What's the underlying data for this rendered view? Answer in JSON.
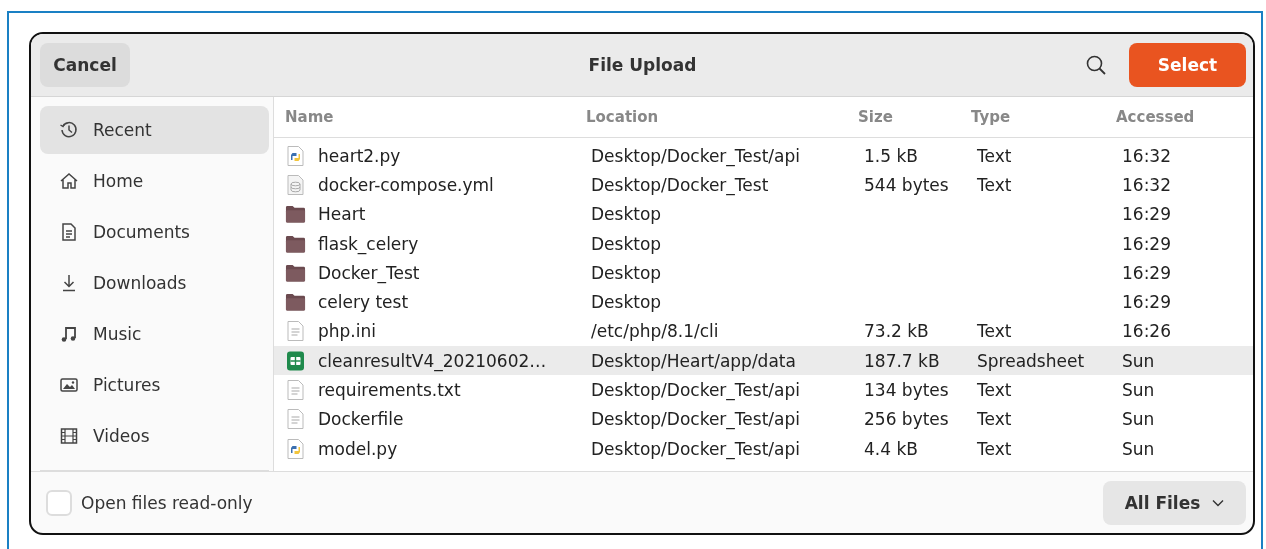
{
  "header": {
    "cancel": "Cancel",
    "title": "File Upload",
    "select": "Select"
  },
  "sidebar": {
    "items": [
      {
        "label": "Recent",
        "kind": "recent",
        "selected": true
      },
      {
        "label": "Home",
        "kind": "home",
        "selected": false
      },
      {
        "label": "Documents",
        "kind": "documents",
        "selected": false
      },
      {
        "label": "Downloads",
        "kind": "downloads",
        "selected": false
      },
      {
        "label": "Music",
        "kind": "music",
        "selected": false
      },
      {
        "label": "Pictures",
        "kind": "pictures",
        "selected": false
      },
      {
        "label": "Videos",
        "kind": "videos",
        "selected": false
      }
    ]
  },
  "table": {
    "columns": [
      "Name",
      "Location",
      "Size",
      "Type",
      "Accessed"
    ],
    "rows": [
      {
        "kind": "python",
        "name": "heart2.py",
        "location": "Desktop/Docker_Test/api",
        "size": "1.5 kB",
        "type": "Text",
        "accessed": "16:32",
        "selected": false
      },
      {
        "kind": "data",
        "name": "docker-compose.yml",
        "location": "Desktop/Docker_Test",
        "size": "544 bytes",
        "type": "Text",
        "accessed": "16:32",
        "selected": false
      },
      {
        "kind": "folder",
        "name": "Heart",
        "location": "Desktop",
        "accessed": "16:29",
        "selected": false
      },
      {
        "kind": "folder",
        "name": "flask_celery",
        "location": "Desktop",
        "accessed": "16:29",
        "selected": false
      },
      {
        "kind": "folder",
        "name": "Docker_Test",
        "location": "Desktop",
        "accessed": "16:29",
        "selected": false
      },
      {
        "kind": "folder",
        "name": "celery test",
        "location": "Desktop",
        "accessed": "16:29",
        "selected": false
      },
      {
        "kind": "text",
        "name": "php.ini",
        "location": "/etc/php/8.1/cli",
        "size": "73.2 kB",
        "type": "Text",
        "accessed": "16:26",
        "selected": false
      },
      {
        "kind": "spreadsheet",
        "name": "cleanresultV4_20210602…",
        "location": "Desktop/Heart/app/data",
        "size": "187.7 kB",
        "type": "Spreadsheet",
        "accessed": "Sun",
        "selected": true
      },
      {
        "kind": "text",
        "name": "requirements.txt",
        "location": "Desktop/Docker_Test/api",
        "size": "134 bytes",
        "type": "Text",
        "accessed": "Sun",
        "selected": false
      },
      {
        "kind": "text",
        "name": "Dockerfile",
        "location": "Desktop/Docker_Test/api",
        "size": "256 bytes",
        "type": "Text",
        "accessed": "Sun",
        "selected": false
      },
      {
        "kind": "python",
        "name": "model.py",
        "location": "Desktop/Docker_Test/api",
        "size": "4.4 kB",
        "type": "Text",
        "accessed": "Sun",
        "selected": false
      }
    ]
  },
  "footer": {
    "read_only": {
      "label": "Open files read-only",
      "checked": false
    },
    "filter": "All Files"
  }
}
